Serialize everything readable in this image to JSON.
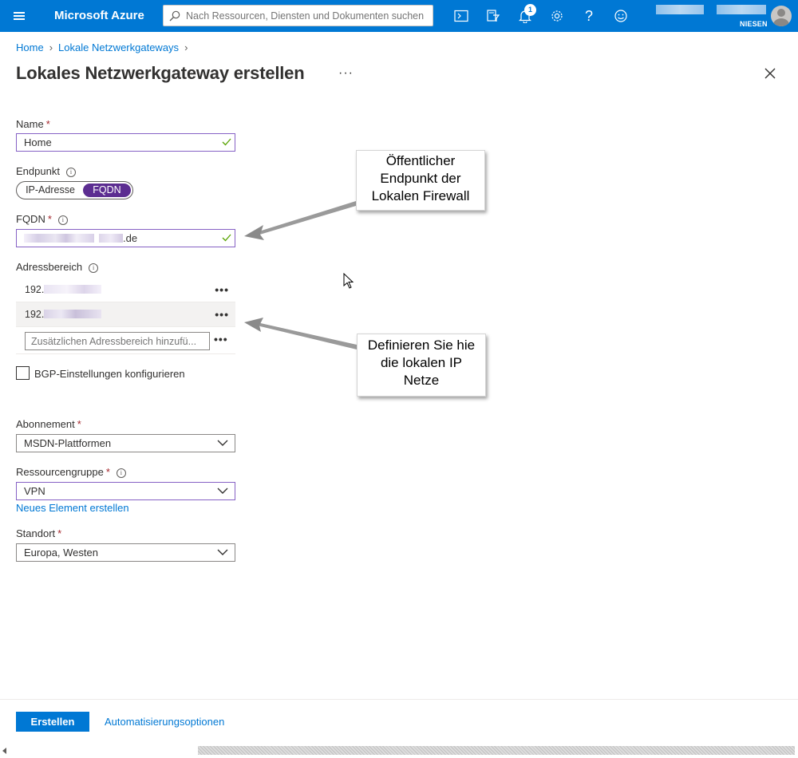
{
  "topbar": {
    "brand": "Microsoft Azure",
    "search_placeholder": "Nach Ressourcen, Diensten und Dokumenten suchen",
    "notification_count": "1",
    "account_directory": "NIESEN",
    "icons": [
      "cloud-shell-icon",
      "directory-filter-icon",
      "notifications-icon",
      "settings-icon",
      "help-icon",
      "feedback-icon"
    ]
  },
  "breadcrumb": [
    "Home",
    "Lokale Netzwerkgateways"
  ],
  "page": {
    "title": "Lokales Netzwerkgateway erstellen",
    "more": "···"
  },
  "form": {
    "name_label": "Name",
    "name_value": "Home",
    "endpoint_label": "Endpunkt",
    "endpoint_options": [
      "IP-Adresse",
      "FQDN"
    ],
    "endpoint_selected": "FQDN",
    "fqdn_label": "FQDN",
    "fqdn_suffix": ".de",
    "address_space_label": "Adressbereich",
    "address_ranges": [
      "192.",
      "192."
    ],
    "address_placeholder": "Zusätzlichen Adressbereich hinzufü...",
    "bgp_label": "BGP-Einstellungen konfigurieren",
    "bgp_checked": false,
    "subscription_label": "Abonnement",
    "subscription_value": "MSDN-Plattformen",
    "resource_group_label": "Ressourcengruppe",
    "resource_group_value": "VPN",
    "new_element_link": "Neues Element erstellen",
    "location_label": "Standort",
    "location_value": "Europa, Westen",
    "required_mark": "*",
    "row_more": "•••"
  },
  "callouts": {
    "public_endpoint": [
      "Öffentlicher",
      "Endpunkt der",
      "Lokalen Firewall"
    ],
    "ip_networks": [
      "Definieren Sie hie",
      "die lokalen IP",
      "Netze"
    ]
  },
  "footer": {
    "create_button": "Erstellen",
    "automation_link": "Automatisierungsoptionen"
  },
  "colors": {
    "accent": "#0078d4",
    "toggle_selected": "#5c2d91",
    "validated_border": "#8661c5",
    "valid_check": "#57a300",
    "required": "#a4262c"
  }
}
